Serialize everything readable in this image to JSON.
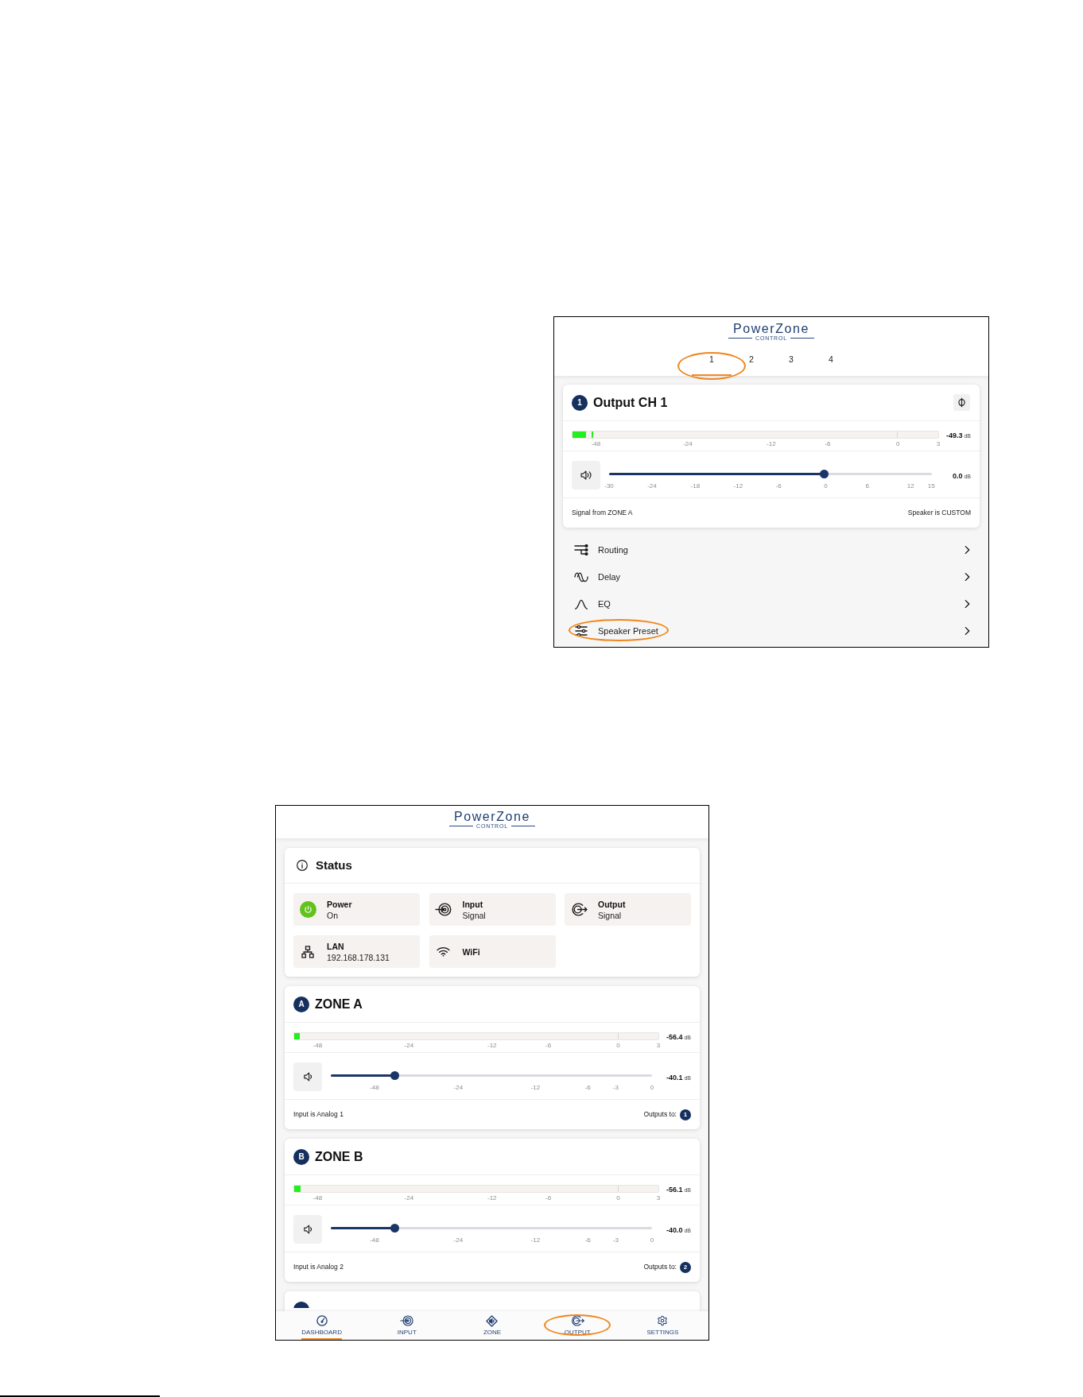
{
  "output_screen": {
    "logo": {
      "name": "PowerZone",
      "tagline": "CONTROL"
    },
    "channel_tabs": [
      {
        "label": "1",
        "selected": true,
        "highlighted": true
      },
      {
        "label": "2",
        "selected": false,
        "highlighted": false
      },
      {
        "label": "3",
        "selected": false,
        "highlighted": false
      },
      {
        "label": "4",
        "selected": false,
        "highlighted": false
      }
    ],
    "channel_card": {
      "kind": "channel",
      "badge": "1",
      "title": "Output CH 1",
      "meter": {
        "level": 0.037,
        "peak": {
          "level": 0.053
        },
        "reading": "-49.3",
        "unit": "dB",
        "scale": [
          "-48",
          "-24",
          "-12",
          "-6",
          "0",
          "3"
        ]
      },
      "volume": {
        "level": 0.667,
        "reading": "0.0",
        "unit": "dB",
        "scale": [
          "-30",
          "-24",
          "-18",
          "-12",
          "-6",
          "0",
          "6",
          "12",
          "15"
        ]
      },
      "footer_left": "Signal from ZONE A",
      "footer_right": "Speaker is CUSTOM"
    },
    "menu": [
      {
        "kind": "routing",
        "label": "Routing",
        "highlighted": false
      },
      {
        "kind": "delay",
        "label": "Delay",
        "highlighted": false
      },
      {
        "kind": "eq",
        "label": "EQ",
        "highlighted": false
      },
      {
        "kind": "preset",
        "label": "Speaker Preset",
        "highlighted": true
      }
    ]
  },
  "dashboard_screen": {
    "logo": {
      "name": "PowerZone",
      "tagline": "CONTROL"
    },
    "status_card": {
      "title": "Status",
      "tiles": [
        {
          "kind": "power",
          "label": "Power",
          "value": "On"
        },
        {
          "kind": "input",
          "label": "Input",
          "value": "Signal"
        },
        {
          "kind": "output",
          "label": "Output",
          "value": "Signal"
        },
        {
          "kind": "lan",
          "label": "LAN",
          "value": "192.168.178.131"
        },
        {
          "kind": "wifi",
          "label": "WiFi"
        }
      ]
    },
    "zones": [
      {
        "kind": "zone",
        "badge": "A",
        "title": "ZONE A",
        "meter": {
          "level": 0.015,
          "reading": "-56.4",
          "unit": "dB",
          "scale": [
            "-48",
            "-24",
            "-12",
            "-6",
            "0",
            "3"
          ]
        },
        "volume": {
          "level": 0.199,
          "reading": "-40.1",
          "unit": "dB",
          "scale": [
            "-48",
            "-24",
            "-12",
            "-6",
            "-3",
            "0"
          ]
        },
        "footer_left": "Input is Analog 1",
        "footer_right": "Outputs to:",
        "outputs": [
          "1"
        ]
      },
      {
        "kind": "zone",
        "badge": "B",
        "title": "ZONE B",
        "meter": {
          "level": 0.017,
          "reading": "-56.1",
          "unit": "dB",
          "scale": [
            "-48",
            "-24",
            "-12",
            "-6",
            "0",
            "3"
          ]
        },
        "volume": {
          "level": 0.2,
          "reading": "-40.0",
          "unit": "dB",
          "scale": [
            "-48",
            "-24",
            "-12",
            "-6",
            "-3",
            "0"
          ]
        },
        "footer_left": "Input is Analog 2",
        "footer_right": "Outputs to:",
        "outputs": [
          "2"
        ]
      },
      {
        "kind": "zone_stub"
      }
    ],
    "nav": [
      {
        "kind": "dashboard",
        "label": "DASHBOARD",
        "selected": true,
        "highlighted": false
      },
      {
        "kind": "input",
        "label": "INPUT",
        "selected": false,
        "highlighted": false
      },
      {
        "kind": "zone",
        "label": "ZONE",
        "selected": false,
        "highlighted": false
      },
      {
        "kind": "output",
        "label": "OUTPUT",
        "selected": false,
        "highlighted": true
      },
      {
        "kind": "settings",
        "label": "SETTINGS",
        "selected": false,
        "highlighted": false
      }
    ]
  }
}
